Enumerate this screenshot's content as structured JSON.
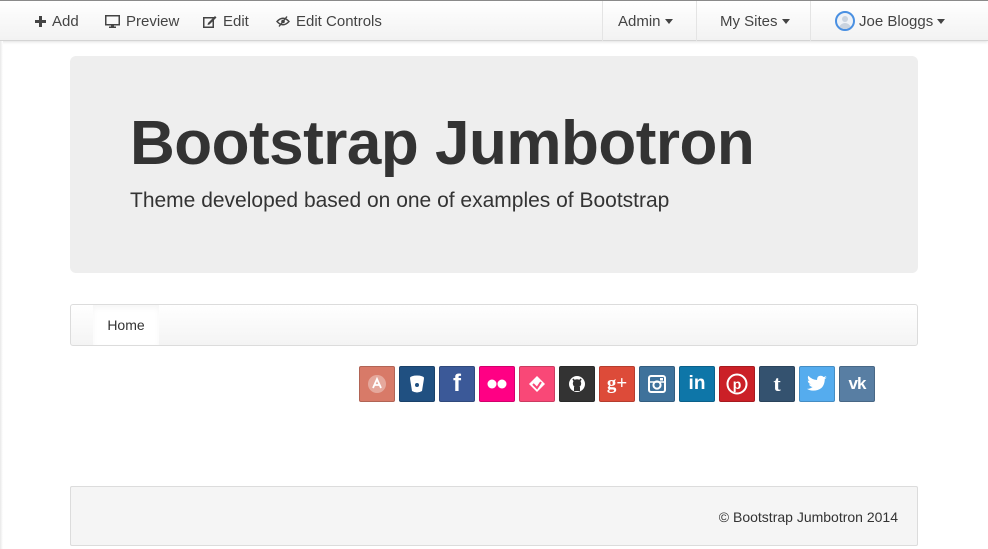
{
  "dockbar": {
    "add_label": "Add",
    "preview_label": "Preview",
    "edit_label": "Edit",
    "edit_controls_label": "Edit Controls",
    "admin_label": "Admin",
    "my_sites_label": "My Sites",
    "user_name": "Joe Bloggs"
  },
  "jumbotron": {
    "title": "Bootstrap Jumbotron",
    "subtitle": "Theme developed based on one of examples of Bootstrap"
  },
  "nav": {
    "items": [
      {
        "label": "Home",
        "active": true
      }
    ]
  },
  "social": [
    {
      "name": "app-net",
      "color": "#d87a68",
      "text": ""
    },
    {
      "name": "bitbucket",
      "color": "#205081",
      "text": ""
    },
    {
      "name": "facebook",
      "color": "#3b5998",
      "text": "f"
    },
    {
      "name": "flickr",
      "color": "#ff0084",
      "text": ""
    },
    {
      "name": "foursquare",
      "color": "#f94877",
      "text": ""
    },
    {
      "name": "github",
      "color": "#333333",
      "text": ""
    },
    {
      "name": "google-plus",
      "color": "#dd4b39",
      "text": "g+"
    },
    {
      "name": "instagram",
      "color": "#3f729b",
      "text": ""
    },
    {
      "name": "linkedin",
      "color": "#0e76a8",
      "text": "in"
    },
    {
      "name": "pinterest",
      "color": "#cb2027",
      "text": "p"
    },
    {
      "name": "tumblr",
      "color": "#34526f",
      "text": "t"
    },
    {
      "name": "twitter",
      "color": "#55acee",
      "text": ""
    },
    {
      "name": "vk",
      "color": "#587ea3",
      "text": "vk"
    }
  ],
  "footer": {
    "text": "© Bootstrap Jumbotron 2014"
  }
}
